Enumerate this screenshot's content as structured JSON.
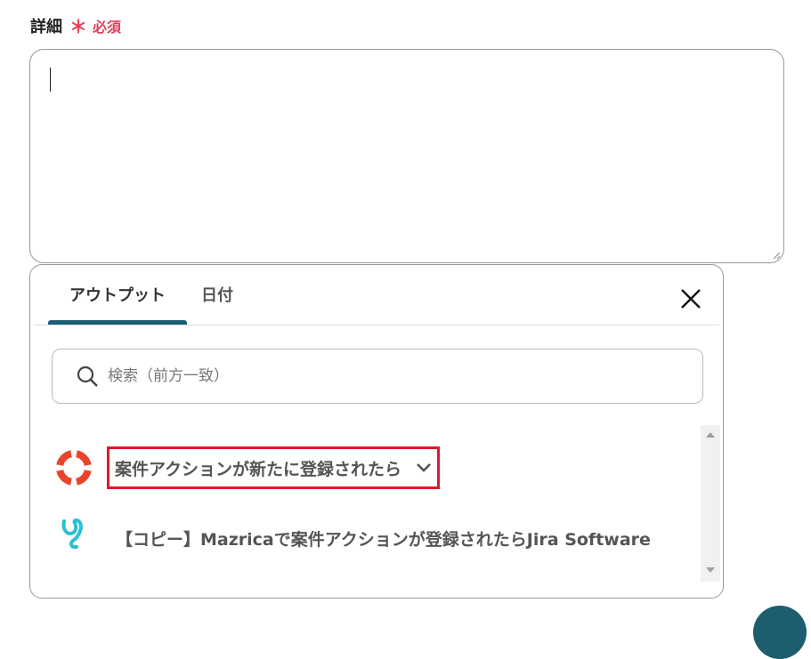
{
  "field": {
    "label": "詳細",
    "required_mark": "＊",
    "required_text": "必須",
    "value": ""
  },
  "popup": {
    "tabs": [
      {
        "label": "アウトプット",
        "active": true
      },
      {
        "label": "日付",
        "active": false
      }
    ],
    "close_icon": "close-icon",
    "search": {
      "placeholder": "検索（前方一致）",
      "value": ""
    },
    "items": [
      {
        "label": "案件アクションが新たに登録されたら",
        "icon": "mazrica-lifebuoy-icon",
        "highlighted": true,
        "expandable": true
      },
      {
        "label": "【コピー】Mazricaで案件アクションが登録されたらJira Software",
        "icon": "yoom-logo-icon",
        "highlighted": false,
        "expandable": false
      }
    ]
  },
  "colors": {
    "accent": "#1b5e73",
    "required": "#e3405a",
    "highlight_border": "#e0182d",
    "mazrica_red": "#e8452c",
    "yoom_teal": "#2bbfcf"
  }
}
